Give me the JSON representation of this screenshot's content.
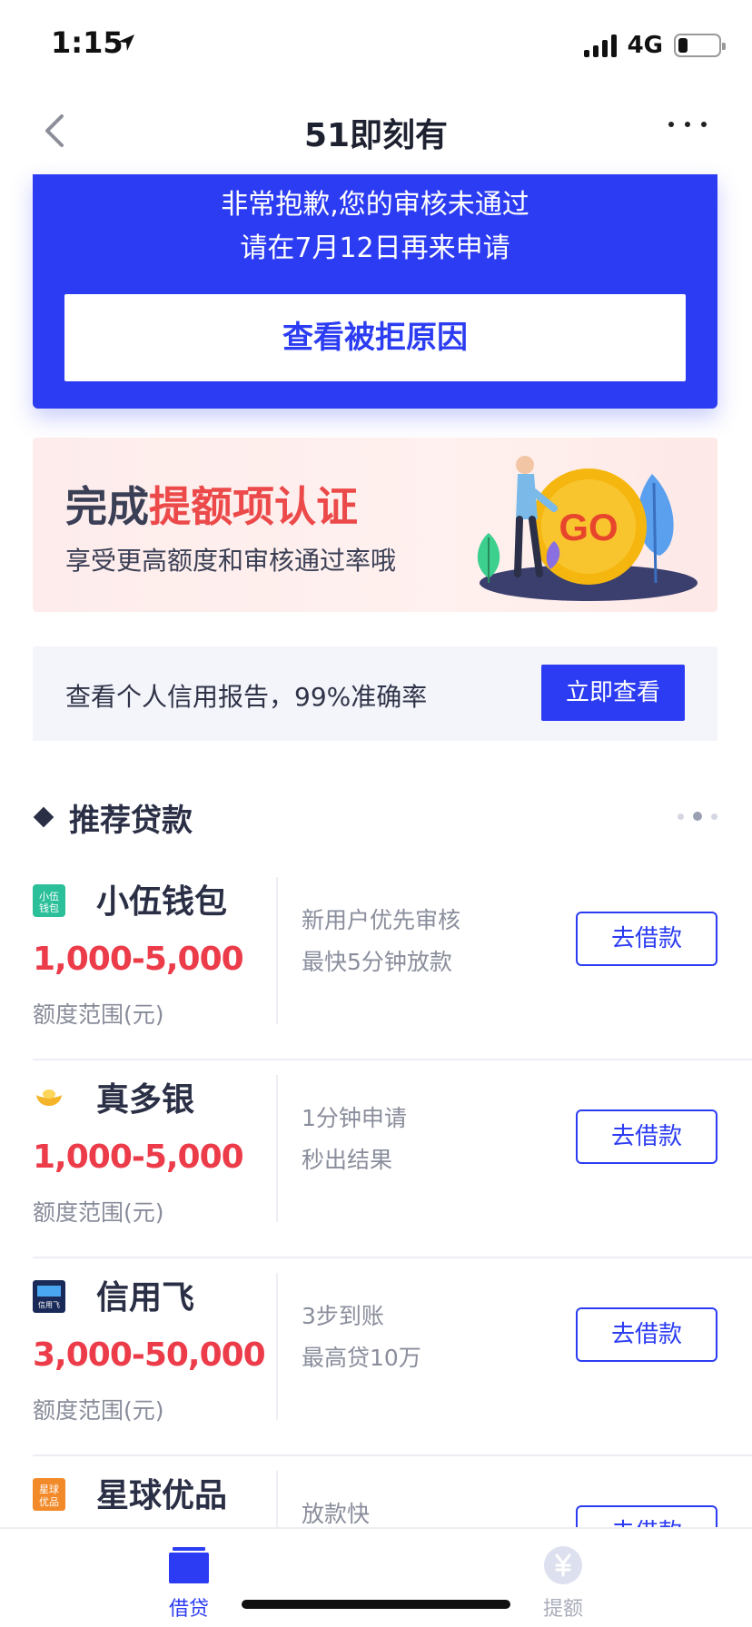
{
  "status_bar": {
    "time": "1:15",
    "network": "4G"
  },
  "nav": {
    "title": "51即刻有"
  },
  "reject": {
    "line1": "非常抱歉,您的审核未通过",
    "line2": "请在7月12日再来申请",
    "button": "查看被拒原因"
  },
  "promo": {
    "title_plain": "完成",
    "title_highlight": "提额项认证",
    "subtitle": "享受更高额度和审核通过率哦",
    "art_text": "GO"
  },
  "credit": {
    "text": "查看个人信用报告，99%准确率",
    "button": "立即查看"
  },
  "section": {
    "title": "推荐贷款"
  },
  "loans": [
    {
      "name": "小伍钱包",
      "range": "1,000-5,000",
      "caption": "额度范围(元)",
      "desc1": "新用户优先审核",
      "desc2": "最快5分钟放款",
      "button": "去借款",
      "logo_text": "小伍钱包",
      "logo_color": "#2bbf9a"
    },
    {
      "name": "真多银",
      "range": "1,000-5,000",
      "caption": "额度范围(元)",
      "desc1": "1分钟申请",
      "desc2": "秒出结果",
      "button": "去借款",
      "logo_text": "",
      "logo_color": "#f5b52a"
    },
    {
      "name": "信用飞",
      "range": "3,000-50,000",
      "caption": "额度范围(元)",
      "desc1": "3步到账",
      "desc2": "最高贷10万",
      "button": "去借款",
      "logo_text": "信用飞",
      "logo_color": "#1a2a58"
    },
    {
      "name": "星球优品",
      "range": "",
      "caption": "",
      "desc1": "放款快",
      "desc2": "",
      "button": "去借款",
      "logo_text": "星球优品",
      "logo_color": "#f28a2a"
    }
  ],
  "tabs": [
    {
      "label": "借贷",
      "icon": "wallet-icon",
      "active": true
    },
    {
      "label": "提额",
      "icon": "yuan-icon",
      "active": false
    }
  ],
  "colors": {
    "primary": "#2c3cf2",
    "accent_red": "#ec3c4a"
  }
}
